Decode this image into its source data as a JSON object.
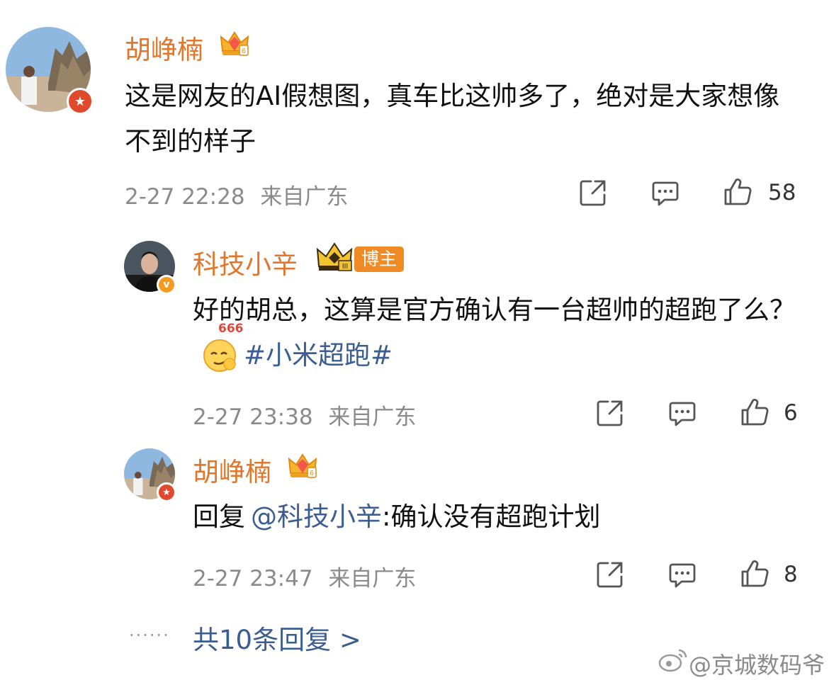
{
  "comments": [
    {
      "author": "胡峥楠",
      "text": "这是网友的AI假想图，真车比这帅多了，绝对是大家想像不到的样子",
      "time": "2-27 22:28",
      "location": "来自广东",
      "likes": "58"
    }
  ],
  "replies": [
    {
      "author": "科技小辛",
      "author_tag": "博主",
      "text": "好的胡总，这算是官方确认有一台超帅的超跑了么？",
      "emoji_label": "666",
      "hashtag": "#小米超跑#",
      "time": "2-27 23:38",
      "location": "来自广东",
      "likes": "6"
    },
    {
      "author": "胡峥楠",
      "reply_prefix": "回复",
      "mention": "@科技小辛",
      "text": ":确认没有超跑计划",
      "time": "2-27 23:47",
      "location": "来自广东",
      "likes": "8"
    }
  ],
  "more_replies": "共10条回复 >",
  "ellipsis": "......",
  "watermark": "@京城数码爷",
  "colors": {
    "name": "#e0772c",
    "meta": "#8a8a8a",
    "link": "#3b5d91",
    "verified_red": "#e04a2c",
    "verified_orange": "#f59a23",
    "blogger_tag": "#f08a24"
  }
}
